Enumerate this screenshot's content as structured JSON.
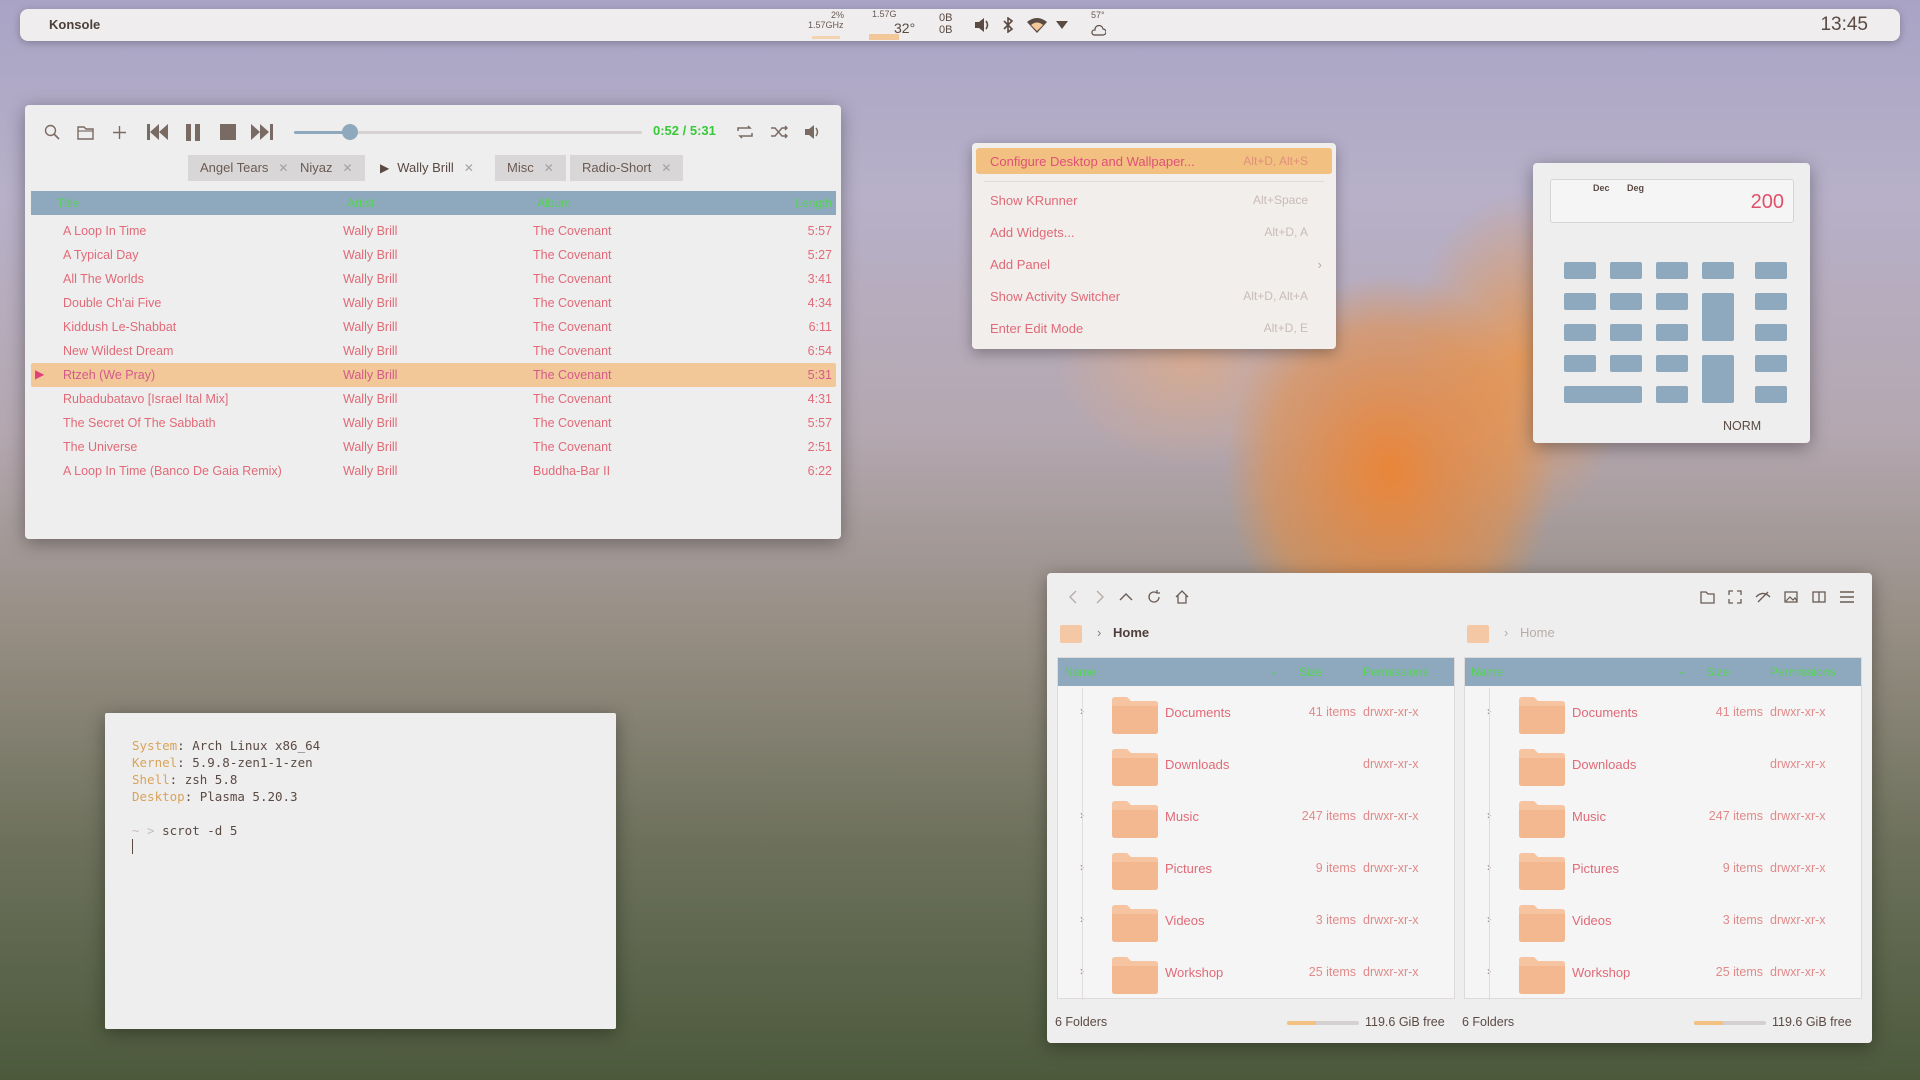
{
  "panel": {
    "app": "Konsole",
    "cpu_pct": "2%",
    "cpu_freq": "1.57GHz",
    "mem": "1.57G",
    "temp": "32°",
    "net_up": "0B",
    "net_down": "0B",
    "weather": "57°",
    "clock": "13:45"
  },
  "player": {
    "time": "0:52 / 5:31",
    "progress": 0.16,
    "tabs": [
      "Angel Tears",
      "Niyaz",
      "Wally Brill",
      "Misc",
      "Radio-Short"
    ],
    "columns": [
      "Title",
      "Artist",
      "Album",
      "Length"
    ],
    "tracks": [
      {
        "title": "A Loop In Time",
        "artist": "Wally Brill",
        "album": "The Covenant",
        "length": "5:57"
      },
      {
        "title": "A Typical Day",
        "artist": "Wally Brill",
        "album": "The Covenant",
        "length": "5:27"
      },
      {
        "title": "All The Worlds",
        "artist": "Wally Brill",
        "album": "The Covenant",
        "length": "3:41"
      },
      {
        "title": "Double Ch'ai Five",
        "artist": "Wally Brill",
        "album": "The Covenant",
        "length": "4:34"
      },
      {
        "title": "Kiddush Le-Shabbat",
        "artist": "Wally Brill",
        "album": "The Covenant",
        "length": "6:11"
      },
      {
        "title": "New Wildest Dream",
        "artist": "Wally Brill",
        "album": "The Covenant",
        "length": "6:54"
      },
      {
        "title": "Rtzeh (We Pray)",
        "artist": "Wally Brill",
        "album": "The Covenant",
        "length": "5:31"
      },
      {
        "title": "Rubadubatavo [Israel Ital Mix]",
        "artist": "Wally Brill",
        "album": "The Covenant",
        "length": "4:31"
      },
      {
        "title": "The Secret Of The Sabbath",
        "artist": "Wally Brill",
        "album": "The Covenant",
        "length": "5:57"
      },
      {
        "title": "The Universe",
        "artist": "Wally Brill",
        "album": "The Covenant",
        "length": "2:51"
      },
      {
        "title": "A Loop In Time (Banco De Gaia Remix)",
        "artist": "Wally Brill",
        "album": "Buddha-Bar II",
        "length": "6:22"
      }
    ]
  },
  "menu": {
    "items": [
      {
        "label": "Configure Desktop and Wallpaper...",
        "shortcut": "Alt+D, Alt+S"
      },
      {
        "label": "Show KRunner",
        "shortcut": "Alt+Space"
      },
      {
        "label": "Add Widgets...",
        "shortcut": "Alt+D, A"
      },
      {
        "label": "Add Panel",
        "shortcut": ""
      },
      {
        "label": "Show Activity Switcher",
        "shortcut": "Alt+D, Alt+A"
      },
      {
        "label": "Enter Edit Mode",
        "shortcut": "Alt+D, E"
      }
    ]
  },
  "calc": {
    "mode_dec": "Dec",
    "mode_deg": "Deg",
    "display": "200",
    "status": "NORM"
  },
  "terminal": {
    "lines": [
      {
        "key": "System",
        "value": ": Arch Linux x86_64"
      },
      {
        "key": "Kernel",
        "value": ": 5.9.8-zen1-1-zen"
      },
      {
        "key": "Shell",
        "value": ": zsh 5.8"
      },
      {
        "key": "Desktop",
        "value": ": Plasma 5.20.3"
      }
    ],
    "prompt": "~ >",
    "command": "scrot -d 5"
  },
  "files": {
    "left": {
      "crumb": "Home",
      "columns": [
        "Name",
        "Size",
        "Permissions"
      ],
      "status": "6 Folders",
      "free": "119.6 GiB free"
    },
    "right": {
      "crumb": "Home",
      "columns": [
        "Name",
        "Size",
        "Permissions"
      ],
      "status": "6 Folders",
      "free": "119.6 GiB free"
    },
    "folders": [
      {
        "name": "Documents",
        "size": "41 items",
        "perm": "drwxr-xr-x"
      },
      {
        "name": "Downloads",
        "size": "",
        "perm": "drwxr-xr-x"
      },
      {
        "name": "Music",
        "size": "247 items",
        "perm": "drwxr-xr-x"
      },
      {
        "name": "Pictures",
        "size": "9 items",
        "perm": "drwxr-xr-x"
      },
      {
        "name": "Videos",
        "size": "3 items",
        "perm": "drwxr-xr-x"
      },
      {
        "name": "Workshop",
        "size": "25 items",
        "perm": "drwxr-xr-x"
      }
    ]
  }
}
